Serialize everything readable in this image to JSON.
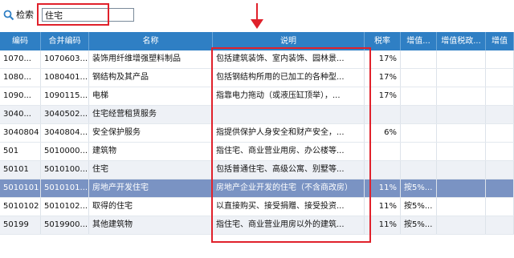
{
  "search": {
    "icon": "search-icon",
    "label": "检索",
    "value": "住宅"
  },
  "accent_color": "#2f7fc4",
  "highlight_color": "#e0212b",
  "table": {
    "columns": [
      "编码",
      "合并编码",
      "名称",
      "说明",
      "税率",
      "增值...",
      "增值税政...",
      "增值"
    ],
    "rows": [
      {
        "code": "1070...",
        "merge": "1070603...",
        "name": "装饰用纤维增强塑料制品",
        "desc": "包括建筑装饰、室内装饰、园林景...",
        "rate": "17%",
        "vat": "",
        "policy": "",
        "extra": ""
      },
      {
        "code": "1080...",
        "merge": "1080401...",
        "name": "钢结构及其产品",
        "desc": "包括钢结构所用的已加工的各种型...",
        "rate": "17%",
        "vat": "",
        "policy": "",
        "extra": ""
      },
      {
        "code": "1090...",
        "merge": "1090115...",
        "name": "电梯",
        "desc": "指靠电力拖动（或液压缸顶举），...",
        "rate": "17%",
        "vat": "",
        "policy": "",
        "extra": ""
      },
      {
        "code": "3040...",
        "merge": "3040502...",
        "name": "住宅经营租赁服务",
        "desc": "",
        "rate": "",
        "vat": "",
        "policy": "",
        "extra": ""
      },
      {
        "code": "3040804",
        "merge": "3040804...",
        "name": "安全保护服务",
        "desc": "指提供保护人身安全和财产安全，...",
        "rate": "6%",
        "vat": "",
        "policy": "",
        "extra": ""
      },
      {
        "code": "501",
        "merge": "5010000...",
        "name": "建筑物",
        "desc": "指住宅、商业营业用房、办公楼等...",
        "rate": "",
        "vat": "",
        "policy": "",
        "extra": ""
      },
      {
        "code": "50101",
        "merge": "5010100...",
        "name": "住宅",
        "desc": "包括普通住宅、高级公寓、别墅等...",
        "rate": "",
        "vat": "",
        "policy": "",
        "extra": ""
      },
      {
        "code": "5010101",
        "merge": "5010101...",
        "name": "房地产开发住宅",
        "desc": "房地产企业开发的住宅（不含商改房）",
        "rate": "11%",
        "vat": "按5%...",
        "policy": "",
        "extra": ""
      },
      {
        "code": "5010102",
        "merge": "5010102...",
        "name": "取得的住宅",
        "desc": "以直接购买、接受捐赠、接受投资...",
        "rate": "11%",
        "vat": "按5%...",
        "policy": "",
        "extra": ""
      },
      {
        "code": "50199",
        "merge": "5019900...",
        "name": "其他建筑物",
        "desc": "指住宅、商业营业用房以外的建筑...",
        "rate": "11%",
        "vat": "按5%...",
        "policy": "",
        "extra": ""
      }
    ]
  }
}
